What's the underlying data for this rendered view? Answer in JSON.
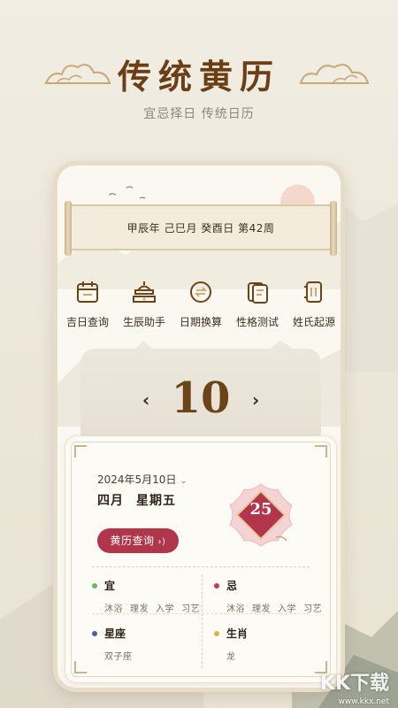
{
  "hero": {
    "title": "传统黄历",
    "subtitle": "宜忌择日 传统日历"
  },
  "banner": {
    "text": "甲辰年  己巳月  癸酉日  第42周"
  },
  "tools": [
    {
      "label": "吉日查询",
      "icon": "calendar-icon"
    },
    {
      "label": "生辰助手",
      "icon": "temple-icon"
    },
    {
      "label": "日期换算",
      "icon": "coin-exchange-icon"
    },
    {
      "label": "性格测试",
      "icon": "card-icon"
    },
    {
      "label": "姓氏起源",
      "icon": "scroll-book-icon"
    }
  ],
  "day_panel": {
    "day": "10",
    "prev": "‹",
    "next": "›"
  },
  "card": {
    "date": "2024年5月10日",
    "date_chevron": "⌄",
    "lunar_month": "四月",
    "weekday": "星期五",
    "badge_number": "25",
    "button_label": "黄历查询",
    "button_arrow": "›)",
    "yi": {
      "title": "宜",
      "items": [
        "沐浴",
        "理发",
        "入学",
        "习艺"
      ],
      "color": "#6db36a"
    },
    "ji": {
      "title": "忌",
      "items": [
        "沐浴",
        "理发",
        "入学",
        "习艺"
      ],
      "color": "#c8394d"
    },
    "xingzuo": {
      "title": "星座",
      "value": "双子座",
      "color": "#4a5bb8"
    },
    "shengxiao": {
      "title": "生肖",
      "value": "龙",
      "color": "#e0b43a"
    }
  },
  "watermark": {
    "text": "KK下载",
    "url": "www.kkx.net"
  },
  "colors": {
    "brand_brown": "#6b3f15",
    "accent_red": "#b2364b"
  }
}
